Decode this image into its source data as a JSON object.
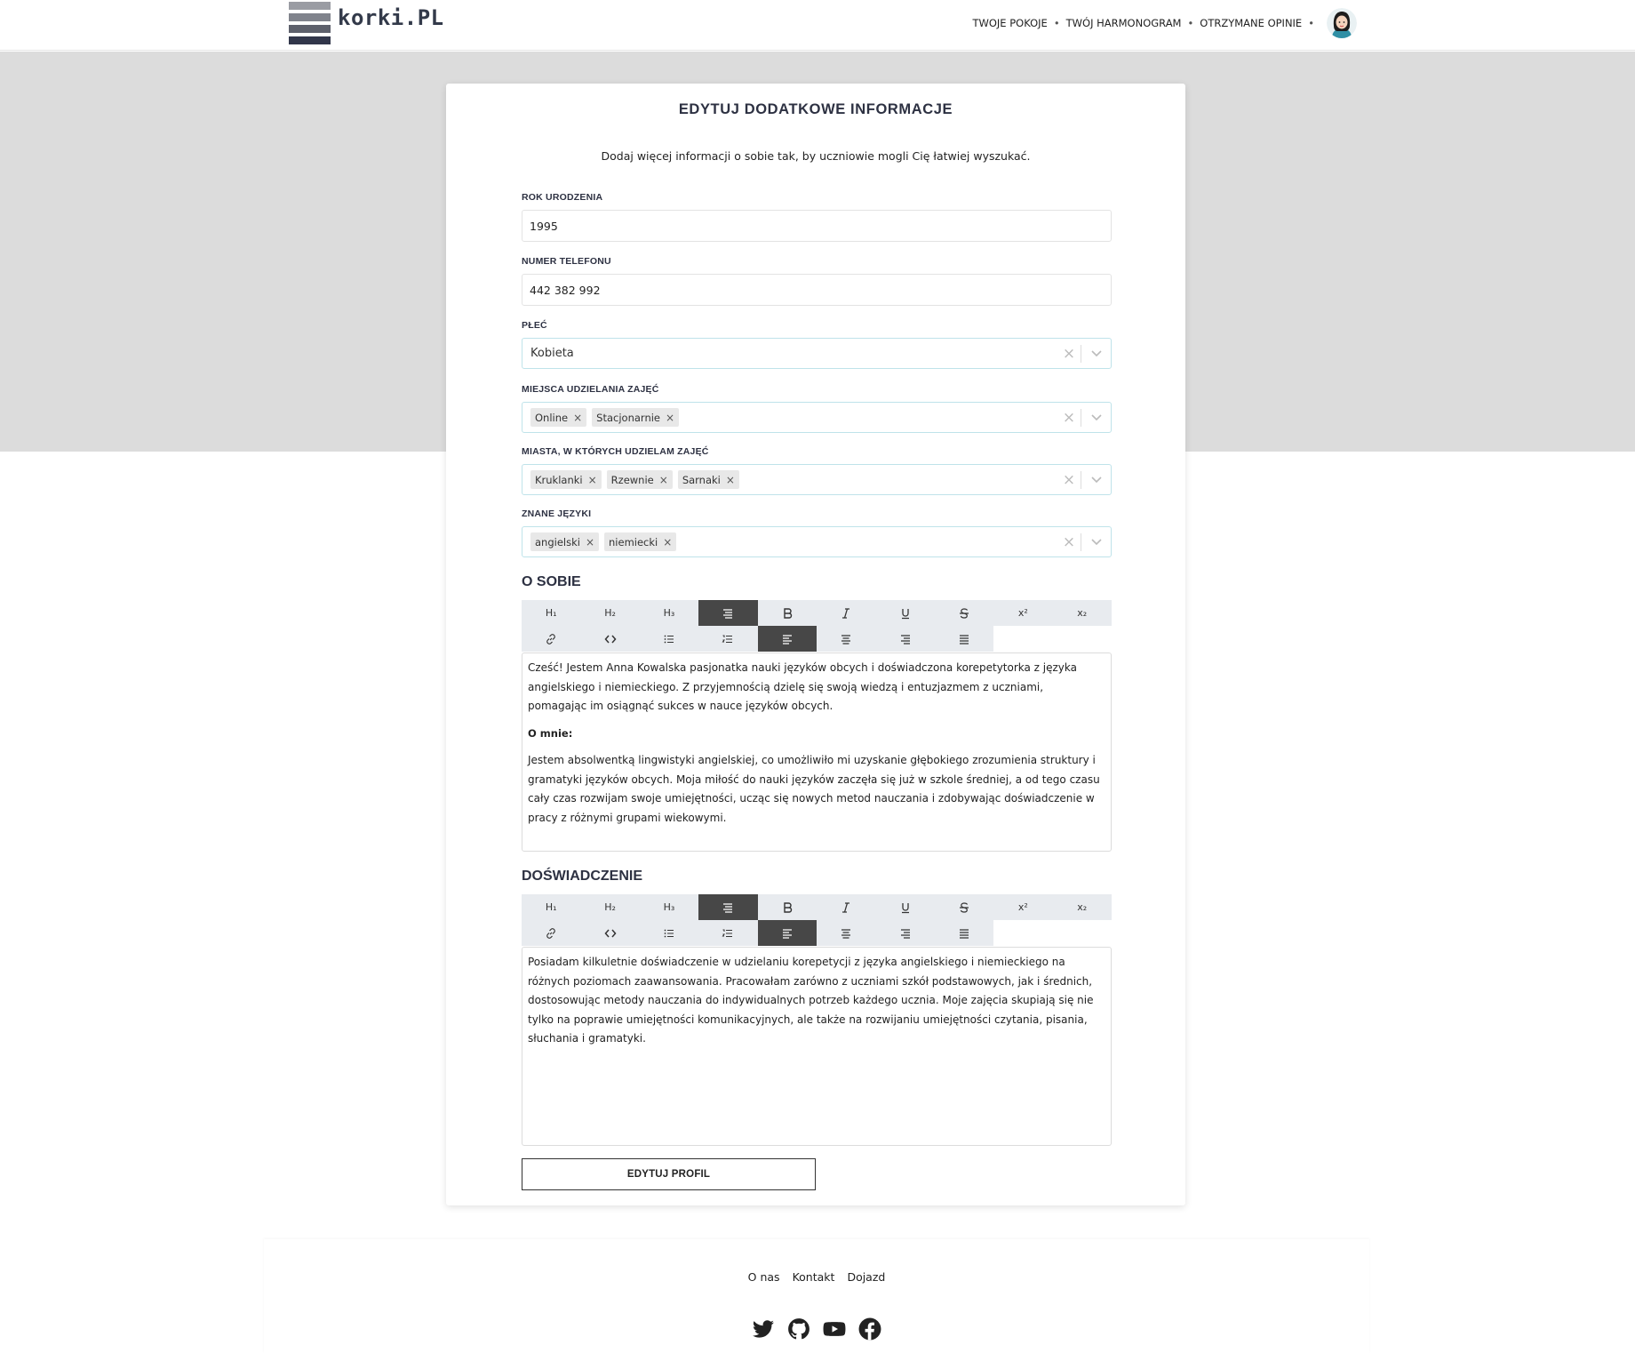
{
  "header": {
    "logo_text": "korki.PL",
    "nav": [
      "TWOJE POKOJE",
      "TWÓJ HARMONOGRAM",
      "OTRZYMANE OPINIE"
    ],
    "nav_separator": "•"
  },
  "form": {
    "title": "EDYTUJ DODATKOWE INFORMACJE",
    "subtitle": "Dodaj więcej informacji o sobie tak, by uczniowie mogli Cię łatwiej wyszukać.",
    "birth_year": {
      "label": "ROK URODZENIA",
      "value": "1995"
    },
    "phone": {
      "label": "NUMER TELEFONU",
      "value": "442 382 992"
    },
    "gender": {
      "label": "PŁEĆ",
      "value": "Kobieta"
    },
    "places": {
      "label": "MIEJSCA UDZIELANIA ZAJĘĆ",
      "chips": [
        "Online",
        "Stacjonarnie"
      ]
    },
    "cities": {
      "label": "MIASTA, W KTÓRYCH UDZIELAM ZAJĘĆ",
      "chips": [
        "Kruklanki",
        "Rzewnie",
        "Sarnaki"
      ]
    },
    "languages": {
      "label": "ZNANE JĘZYKI",
      "chips": [
        "angielski",
        "niemiecki"
      ]
    },
    "chip_remove": "×",
    "clear_symbol": "×",
    "about": {
      "title": "O SOBIE",
      "paragraphs": [
        "Cześć! Jestem Anna Kowalska pasjonatka nauki języków obcych i doświadczona korepetytorka z języka angielskiego i niemieckiego. Z przyjemnością dzielę się swoją wiedzą i entuzjazmem z uczniami, pomagając im osiągnąć sukces w nauce języków obcych.",
        "O mnie:",
        "Jestem absolwentką lingwistyki angielskiej, co umożliwiło mi uzyskanie głębokiego zrozumienia struktury i gramatyki języków obcych. Moja miłość do nauki języków zaczęła się już w szkole średniej, a od tego czasu cały czas rozwijam swoje umiejętności, ucząc się nowych metod nauczania i zdobywając doświadczenie w pracy z różnymi grupami wiekowymi."
      ]
    },
    "experience": {
      "title": "DOŚWIADCZENIE",
      "paragraphs": [
        "Posiadam kilkuletnie doświadczenie w udzielaniu korepetycji z języka angielskiego i niemieckiego na różnych poziomach zaawansowania. Pracowałam zarówno z uczniami szkół podstawowych, jak i średnich, dostosowując metody nauczania do indywidualnych potrzeb każdego ucznia. Moje zajęcia skupiają się nie tylko na poprawie umiejętności komunikacyjnych, ale także na rozwijaniu umiejętności czytania, pisania, słuchania i gramatyki."
      ]
    },
    "toolbar_labels": {
      "h1": "H₁",
      "h2": "H₂",
      "h3": "H₃",
      "sup": "x²",
      "sub": "x₂"
    },
    "submit_label": "EDYTUJ PROFIL"
  },
  "footer": {
    "links": [
      "O nas",
      "Kontakt",
      "Dojazd"
    ],
    "social_icons": [
      "twitter-icon",
      "github-icon",
      "youtube-icon",
      "facebook-icon"
    ]
  },
  "colors": {
    "band": "#dcdcdc",
    "active_tool": "#474747",
    "tool_bg": "#e8ebef",
    "select_border": "#bfe3ea",
    "heading": "#2d3142"
  }
}
